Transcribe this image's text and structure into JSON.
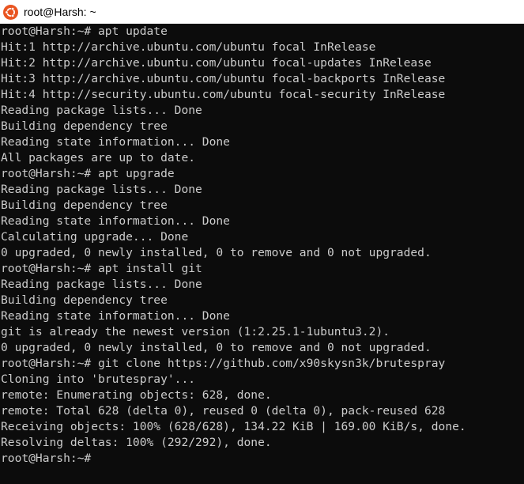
{
  "window": {
    "title": "root@Harsh: ~",
    "icon": "ubuntu-logo-icon",
    "accent_color": "#e95420"
  },
  "terminal": {
    "background": "#0c0c0c",
    "foreground": "#cccccc",
    "lines": [
      "root@Harsh:~# apt update",
      "Hit:1 http://archive.ubuntu.com/ubuntu focal InRelease",
      "Hit:2 http://archive.ubuntu.com/ubuntu focal-updates InRelease",
      "Hit:3 http://archive.ubuntu.com/ubuntu focal-backports InRelease",
      "Hit:4 http://security.ubuntu.com/ubuntu focal-security InRelease",
      "Reading package lists... Done",
      "Building dependency tree",
      "Reading state information... Done",
      "All packages are up to date.",
      "root@Harsh:~# apt upgrade",
      "Reading package lists... Done",
      "Building dependency tree",
      "Reading state information... Done",
      "Calculating upgrade... Done",
      "0 upgraded, 0 newly installed, 0 to remove and 0 not upgraded.",
      "root@Harsh:~# apt install git",
      "Reading package lists... Done",
      "Building dependency tree",
      "Reading state information... Done",
      "git is already the newest version (1:2.25.1-1ubuntu3.2).",
      "0 upgraded, 0 newly installed, 0 to remove and 0 not upgraded.",
      "root@Harsh:~# git clone https://github.com/x90skysn3k/brutespray",
      "Cloning into 'brutespray'...",
      "remote: Enumerating objects: 628, done.",
      "remote: Total 628 (delta 0), reused 0 (delta 0), pack-reused 628",
      "Receiving objects: 100% (628/628), 134.22 KiB | 169.00 KiB/s, done.",
      "Resolving deltas: 100% (292/292), done.",
      "root@Harsh:~#"
    ]
  }
}
